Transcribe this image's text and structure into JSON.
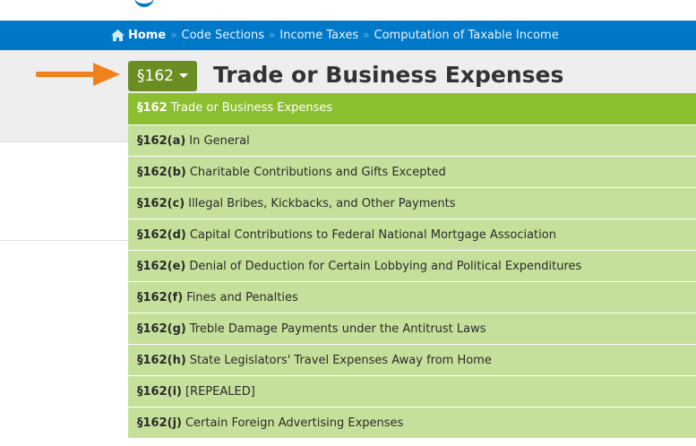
{
  "breadcrumb": {
    "home": "Home",
    "items": [
      "Code Sections",
      "Income Taxes",
      "Computation of Taxable Income"
    ],
    "separator": "»"
  },
  "section_button": {
    "label": "§162"
  },
  "page_title": "Trade or Business Expenses",
  "dropdown": {
    "items": [
      {
        "num": "§162",
        "text": "Trade or Business Expenses"
      },
      {
        "num": "§162(a)",
        "text": "In General"
      },
      {
        "num": "§162(b)",
        "text": "Charitable Contributions and Gifts Excepted"
      },
      {
        "num": "§162(c)",
        "text": "Illegal Bribes, Kickbacks, and Other Payments"
      },
      {
        "num": "§162(d)",
        "text": "Capital Contributions to Federal National Mortgage Association"
      },
      {
        "num": "§162(e)",
        "text": "Denial of Deduction for Certain Lobbying and Political Expenditures"
      },
      {
        "num": "§162(f)",
        "text": "Fines and Penalties"
      },
      {
        "num": "§162(g)",
        "text": "Treble Damage Payments under the Antitrust Laws"
      },
      {
        "num": "§162(h)",
        "text": "State Legislators' Travel Expenses Away from Home"
      },
      {
        "num": "§162(i)",
        "text": "[REPEALED]"
      },
      {
        "num": "§162(j)",
        "text": "Certain Foreign Advertising Expenses"
      }
    ]
  },
  "colors": {
    "breadcrumb_bg": "#0078c8",
    "button_bg": "#6b8e23",
    "active_item_bg": "#8cbf2f",
    "item_bg": "#c5e09a",
    "arrow": "#f0821e"
  },
  "icons": {
    "home": "home-icon",
    "caret": "caret-down-icon",
    "pointer": "arrow-right-icon"
  }
}
